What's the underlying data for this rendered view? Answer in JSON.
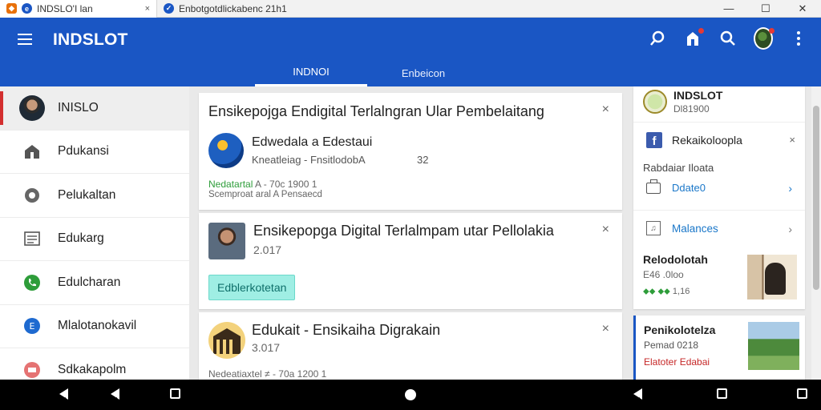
{
  "browser": {
    "tabs": [
      {
        "title": "INDSLO'I lan",
        "close": "×",
        "favicon_color": "#e8710a"
      },
      {
        "title": "Enbotgotdlickabenc 21h1",
        "favicon_color": "#1a56c4"
      }
    ],
    "window_controls": [
      "—",
      "☐",
      "✕"
    ]
  },
  "appbar": {
    "title": "INDSLOT",
    "tabs": [
      {
        "label": "INDNOI",
        "active": true
      },
      {
        "label": "Enbeicon",
        "active": false
      }
    ],
    "background": "#1a56c4"
  },
  "sidebar": {
    "items": [
      {
        "label": "INISLO",
        "icon": "avatar"
      },
      {
        "label": "Pdukansi",
        "icon": "home-icon"
      },
      {
        "label": "Pelukaltan",
        "icon": "settings-icon"
      },
      {
        "label": "Edukarg",
        "icon": "document-icon"
      },
      {
        "label": "Edulcharan",
        "icon": "phone-icon"
      },
      {
        "label": "Mlalotanokavil",
        "icon": "info-icon"
      },
      {
        "label": "Sdkakapolm",
        "icon": "calendar-icon"
      }
    ]
  },
  "feed": {
    "card1": {
      "title": "Ensikepojga Endigital Terlalngran Ular Pembelaitang",
      "name": "Edwedala a Edestaui",
      "sub": "Kneatleiag - FnsitlodobA",
      "num": "32",
      "meta_green": "Nedatartal",
      "meta_rest": "A - 70c 1900 1",
      "meta2": "Scemproat aral A Pensaecd",
      "close": "×"
    },
    "card2": {
      "title": "Ensikepopga Digital Terlalmpam utar Pellolakia",
      "sub": "2.017",
      "chip": "Edblerkotetan",
      "close": "×"
    },
    "card3": {
      "title": "Edukait - Ensikaiha Digrakain",
      "sub": "3.017",
      "meta": "Nedeatiaxtel  ≠ - 70a 1200 1",
      "close": "×"
    }
  },
  "right": {
    "profile": {
      "title": "INDSLOT",
      "sub": "Dl81900"
    },
    "fb_row": {
      "label": "Rekaikoloopla",
      "close": "×"
    },
    "plain": "Rabdaiar Iloata",
    "update": {
      "label": "Ddate0",
      "arrow": "›"
    },
    "malances": {
      "label": "Malances",
      "arrow": "›"
    },
    "related": {
      "title": "Relodolotah",
      "sub": "E46 .0loo",
      "meta_green": "⬥⬥ ⬥⬥",
      "meta_rest": "1,16"
    },
    "card2": {
      "title": "Penikolotelza",
      "sub": "Pemad 0218",
      "red": "Elatoter Edabai"
    }
  },
  "navbar": {
    "buttons": [
      "back",
      "back",
      "recents",
      "home",
      "back",
      "recents",
      "recents"
    ]
  }
}
